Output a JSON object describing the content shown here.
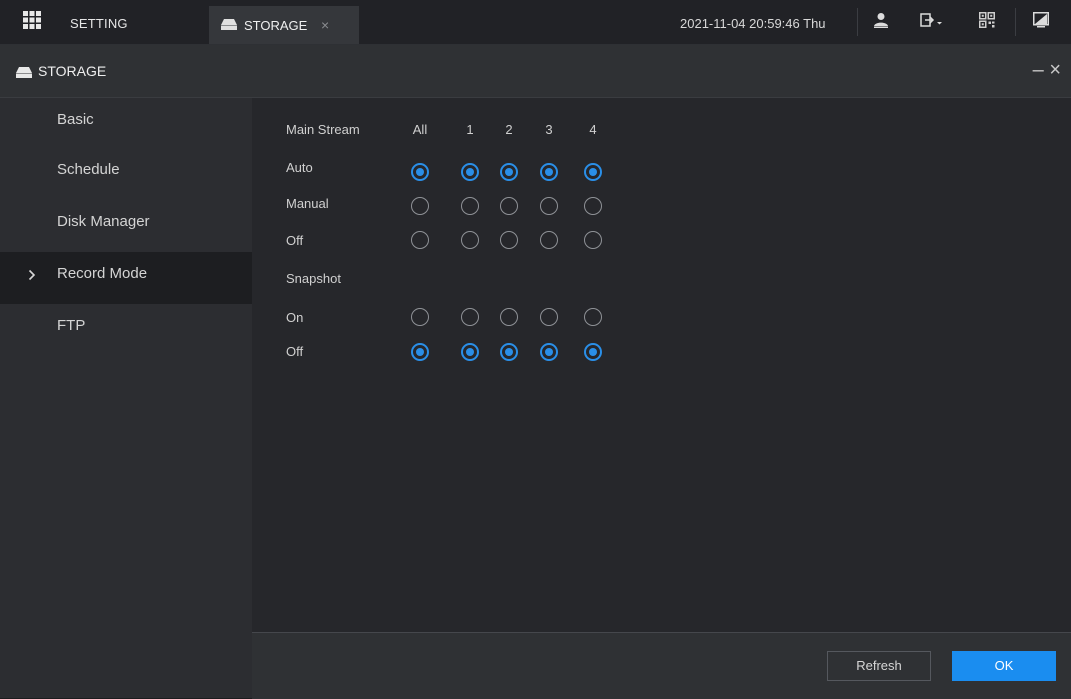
{
  "topbar": {
    "menu_label": "SETTING",
    "tab_label": "STORAGE",
    "tab_close": "×",
    "datetime": "2021-11-04 20:59:46 Thu"
  },
  "window": {
    "title": "STORAGE",
    "minimize": "–",
    "close": "×"
  },
  "sidebar": {
    "items": [
      {
        "label": "Basic"
      },
      {
        "label": "Schedule"
      },
      {
        "label": "Disk Manager"
      },
      {
        "label": "Record Mode"
      },
      {
        "label": "FTP"
      }
    ]
  },
  "record": {
    "stream_label": "Main Stream",
    "columns": [
      "All",
      "1",
      "2",
      "3",
      "4"
    ],
    "rows": [
      {
        "label": "Auto",
        "selected": true
      },
      {
        "label": "Manual",
        "selected": false
      },
      {
        "label": "Off",
        "selected": false
      }
    ]
  },
  "snapshot": {
    "label": "Snapshot",
    "rows": [
      {
        "label": "On",
        "selected": false
      },
      {
        "label": "Off",
        "selected": true
      }
    ]
  },
  "footer": {
    "refresh_label": "Refresh",
    "ok_label": "OK"
  },
  "colors": {
    "accent": "#1a8df0",
    "radio_selected": "#2a8fe8"
  }
}
